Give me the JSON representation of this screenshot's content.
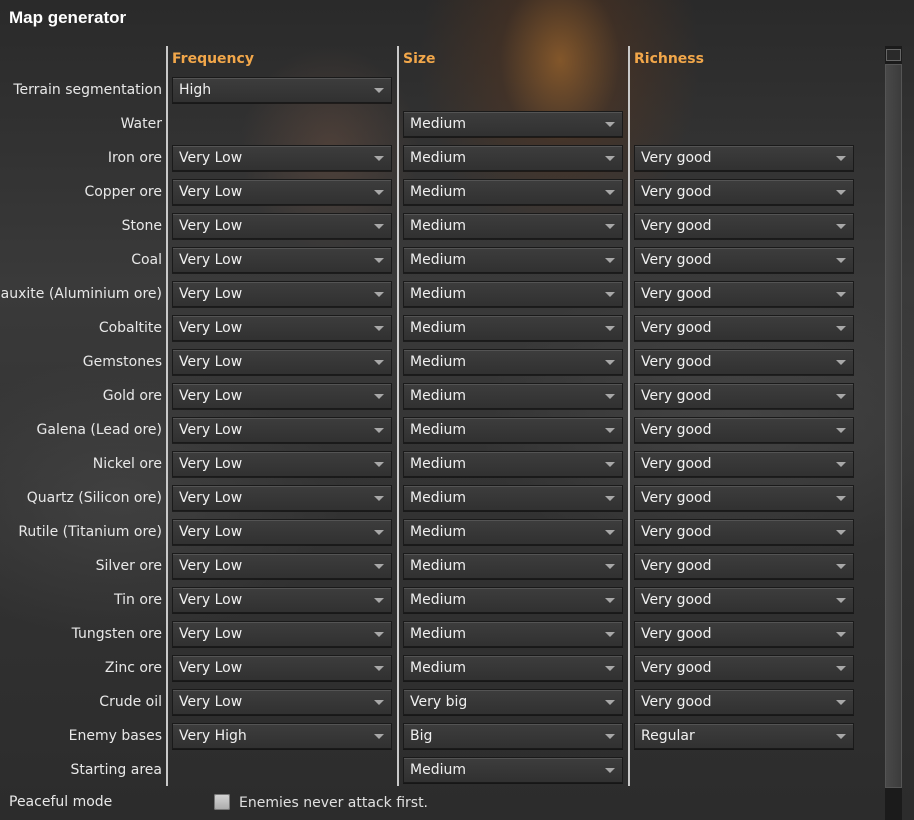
{
  "window": {
    "title": "Map generator"
  },
  "columns": [
    "Frequency",
    "Size",
    "Richness"
  ],
  "rows": [
    {
      "label": "Terrain segmentation",
      "frequency": "High",
      "size": null,
      "richness": null
    },
    {
      "label": "Water",
      "frequency": null,
      "size": "Medium",
      "richness": null
    },
    {
      "label": "Iron ore",
      "frequency": "Very Low",
      "size": "Medium",
      "richness": "Very good"
    },
    {
      "label": "Copper ore",
      "frequency": "Very Low",
      "size": "Medium",
      "richness": "Very good"
    },
    {
      "label": "Stone",
      "frequency": "Very Low",
      "size": "Medium",
      "richness": "Very good"
    },
    {
      "label": "Coal",
      "frequency": "Very Low",
      "size": "Medium",
      "richness": "Very good"
    },
    {
      "label": "Bauxite (Aluminium ore)",
      "frequency": "Very Low",
      "size": "Medium",
      "richness": "Very good"
    },
    {
      "label": "Cobaltite",
      "frequency": "Very Low",
      "size": "Medium",
      "richness": "Very good"
    },
    {
      "label": "Gemstones",
      "frequency": "Very Low",
      "size": "Medium",
      "richness": "Very good"
    },
    {
      "label": "Gold ore",
      "frequency": "Very Low",
      "size": "Medium",
      "richness": "Very good"
    },
    {
      "label": "Galena (Lead ore)",
      "frequency": "Very Low",
      "size": "Medium",
      "richness": "Very good"
    },
    {
      "label": "Nickel ore",
      "frequency": "Very Low",
      "size": "Medium",
      "richness": "Very good"
    },
    {
      "label": "Quartz (Silicon ore)",
      "frequency": "Very Low",
      "size": "Medium",
      "richness": "Very good"
    },
    {
      "label": "Rutile (Titanium ore)",
      "frequency": "Very Low",
      "size": "Medium",
      "richness": "Very good"
    },
    {
      "label": "Silver ore",
      "frequency": "Very Low",
      "size": "Medium",
      "richness": "Very good"
    },
    {
      "label": "Tin ore",
      "frequency": "Very Low",
      "size": "Medium",
      "richness": "Very good"
    },
    {
      "label": "Tungsten ore",
      "frequency": "Very Low",
      "size": "Medium",
      "richness": "Very good"
    },
    {
      "label": "Zinc ore",
      "frequency": "Very Low",
      "size": "Medium",
      "richness": "Very good"
    },
    {
      "label": "Crude oil",
      "frequency": "Very Low",
      "size": "Very big",
      "richness": "Very good"
    },
    {
      "label": "Enemy bases",
      "frequency": "Very High",
      "size": "Big",
      "richness": "Regular"
    },
    {
      "label": "Starting area",
      "frequency": null,
      "size": "Medium",
      "richness": null
    }
  ],
  "peaceful": {
    "label": "Peaceful mode",
    "checkbox_text": "Enemies never attack first.",
    "checked": false
  },
  "icons": {
    "dropdown": "chevron-down-icon",
    "scroll": "scrollbar"
  },
  "colors": {
    "header": "#f2a74a",
    "text": "#e8e8e8",
    "dropdown_bg": "#373737"
  }
}
